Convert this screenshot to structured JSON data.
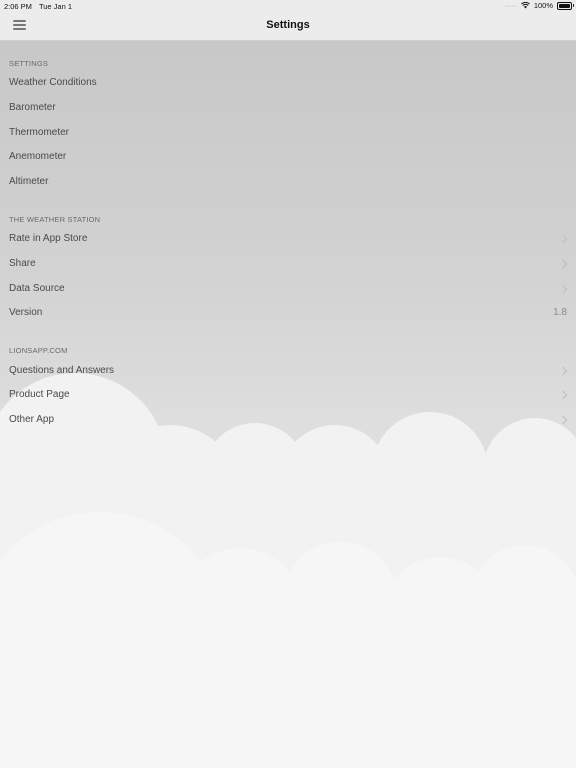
{
  "status_bar": {
    "time": "2:06 PM",
    "date": "Tue Jan 1",
    "battery": "100%",
    "wifi_icon": "wifi-icon",
    "battery_icon": "battery-icon"
  },
  "navbar": {
    "title": "Settings",
    "menu_icon": "hamburger-menu-icon"
  },
  "sections": {
    "settings": {
      "header": "SETTINGS",
      "items": [
        {
          "label": "Weather Conditions"
        },
        {
          "label": "Barometer"
        },
        {
          "label": "Thermometer"
        },
        {
          "label": "Anemometer"
        },
        {
          "label": "Altimeter"
        }
      ]
    },
    "station": {
      "header": "THE WEATHER STATION",
      "items": [
        {
          "label": "Rate in App Store"
        },
        {
          "label": "Share"
        },
        {
          "label": "Data Source"
        },
        {
          "label": "Version",
          "value": "1.8"
        }
      ]
    },
    "lionsapp": {
      "header": "LIONSAPP.COM",
      "items": [
        {
          "label": "Questions and Answers"
        },
        {
          "label": "Product Page"
        },
        {
          "label": "Other App"
        }
      ]
    }
  },
  "colors": {
    "navbar_bg": "#ececec",
    "background_top": "#c6c6c6",
    "cloud": "#f5f5f5"
  }
}
